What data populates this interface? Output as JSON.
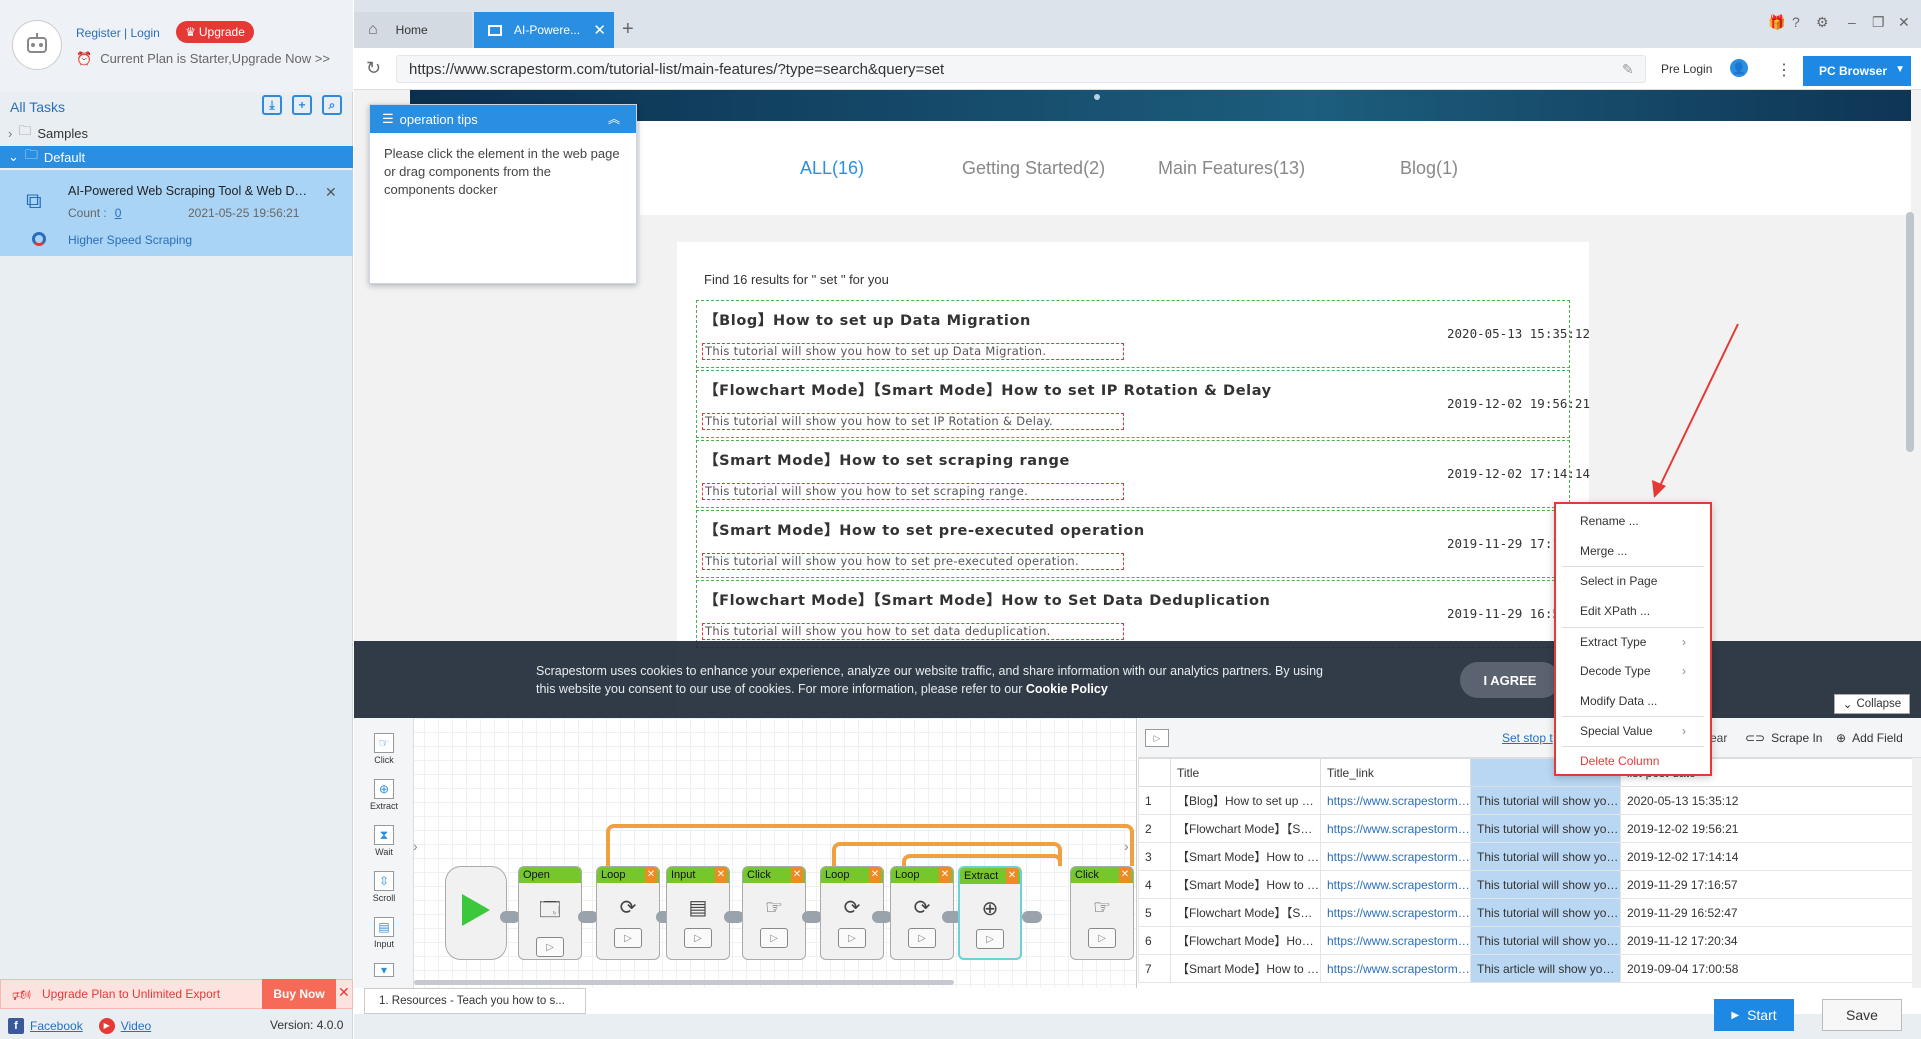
{
  "sidebar": {
    "register_login": "Register | Login",
    "upgrade": "Upgrade",
    "plan_text": "Current Plan is Starter,Upgrade Now >>",
    "all_tasks": "All Tasks",
    "tree": {
      "samples": "Samples",
      "default": "Default"
    },
    "task": {
      "title": "AI-Powered Web Scraping Tool & Web Dat...",
      "count_label": "Count :",
      "count_value": "0",
      "date": "2021-05-25 19:56:21",
      "speed_label": "Higher Speed Scraping"
    },
    "upgrade_bar": {
      "text": "Upgrade Plan to Unlimited Export",
      "buy_now": "Buy Now"
    },
    "footer": {
      "facebook": "Facebook",
      "video": "Video",
      "version": "Version: 4.0.0"
    }
  },
  "browser": {
    "tabs": [
      {
        "label": "Home"
      },
      {
        "label": "AI-Powere..."
      }
    ],
    "url": "https://www.scrapestorm.com/tutorial-list/main-features/?type=search&query=set",
    "pre_login": "Pre Login",
    "pc_browser": "PC Browser"
  },
  "webpage": {
    "nav_tabs": [
      "ALL(16)",
      "Getting Started(2)",
      "Main Features(13)",
      "Blog(1)"
    ],
    "results_text": "Find 16 results for \" set \" for you",
    "results": [
      {
        "title": "【Blog】How to set up Data Migration",
        "date": "2020-05-13 15:35:12",
        "desc": "This tutorial will show you how to set up Data Migration."
      },
      {
        "title": "【Flowchart Mode】【Smart Mode】How to set IP Rotation & Delay",
        "date": "2019-12-02 19:56:21",
        "desc": "This tutorial will show you how to set IP Rotation & Delay."
      },
      {
        "title": "【Smart Mode】How to set scraping range",
        "date": "2019-12-02 17:14:14",
        "desc": "This tutorial will show you how to set scraping range."
      },
      {
        "title": "【Smart Mode】How to set pre-executed operation",
        "date": "2019-11-29 17:16:",
        "desc": "This tutorial will show you how to set pre-executed operation."
      },
      {
        "title": "【Flowchart Mode】【Smart Mode】How to Set Data Deduplication",
        "date": "2019-11-29 16:52:",
        "desc": "This tutorial will show you how to set data deduplication."
      }
    ],
    "tips": {
      "title": "operation tips",
      "body": "Please click the element in the web page or drag components from the components docker"
    },
    "cookie": {
      "text": "Scrapestorm uses cookies to enhance your experience, analyze our website traffic, and share information with our analytics partners. By using this website you consent to our use of cookies. For more information, please refer to our",
      "policy": "Cookie Policy",
      "agree": "I AGREE"
    },
    "collapse": "Collapse"
  },
  "flow": {
    "tools": [
      "Click",
      "Extract",
      "Wait",
      "Scroll",
      "Input"
    ],
    "nodes": [
      "Open",
      "Loop",
      "Input",
      "Click",
      "Loop",
      "Loop",
      "Extract",
      "Click"
    ],
    "resource_tab": "1. Resources - Teach you how to s..."
  },
  "table": {
    "toolbar": {
      "set_stop": "Set stop t",
      "clear": "ear",
      "scrape_in": "Scrape In",
      "add_field": "Add Field"
    },
    "columns": [
      "",
      "Title",
      "Title_link",
      "",
      "list-post-date"
    ],
    "rows": [
      [
        "1",
        "【Blog】How to set up Data ...",
        "https://www.scrapestorm.com/...",
        "This tutorial will show you ho...",
        "2020-05-13 15:35:12"
      ],
      [
        "2",
        "【Flowchart Mode】【Smart ...",
        "https://www.scrapestorm.com/...",
        "This tutorial will show you ho...",
        "2019-12-02 19:56:21"
      ],
      [
        "3",
        "【Smart Mode】How to set s...",
        "https://www.scrapestorm.com/...",
        "This tutorial will show you ho...",
        "2019-12-02 17:14:14"
      ],
      [
        "4",
        "【Smart Mode】How to set pr...",
        "https://www.scrapestorm.com/...",
        "This tutorial will show you ho...",
        "2019-11-29 17:16:57"
      ],
      [
        "5",
        "【Flowchart Mode】【Smart ...",
        "https://www.scrapestorm.com/...",
        "This tutorial will show you ho...",
        "2019-11-29 16:52:47"
      ],
      [
        "6",
        "【Flowchart Mode】How to s...",
        "https://www.scrapestorm.com/...",
        "This tutorial will show you ho...",
        "2019-11-12 17:20:34"
      ],
      [
        "7",
        "【Smart Mode】How to set u...",
        "https://www.scrapestorm.com/...",
        "This article will show you how ...",
        "2019-09-04 17:00:58"
      ]
    ],
    "start": "Start",
    "save": "Save"
  },
  "context_menu": {
    "items": [
      "Rename ...",
      "Merge ...",
      "Select in Page",
      "Edit XPath ...",
      "Extract Type",
      "Decode Type",
      "Modify Data ...",
      "Special Value",
      "Delete Column"
    ]
  },
  "colors": {
    "accent": "#2b8fe1",
    "danger": "#e53935",
    "node_header": "#76c72b",
    "loop_line": "#f0a040"
  }
}
